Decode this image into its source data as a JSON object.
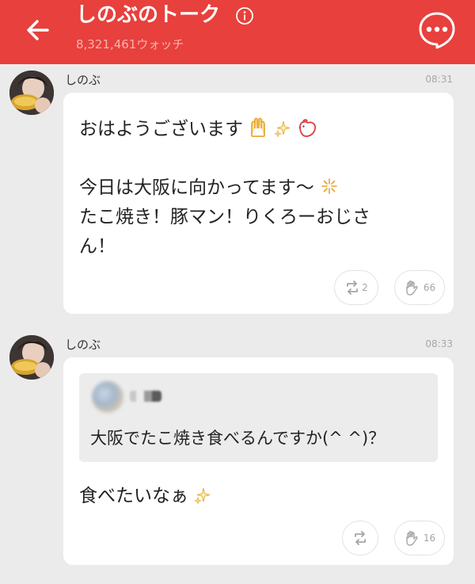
{
  "header": {
    "title": "しのぶのトーク",
    "watchers": "8,321,461ウォッチ",
    "back_icon": "arrow-left-icon",
    "info_icon": "info-icon",
    "chat_icon": "chat-bubble-icon"
  },
  "colors": {
    "header_bg": "#e8403c",
    "background": "#ebebeb",
    "card": "#ffffff"
  },
  "posts": [
    {
      "author": "しのぶ",
      "time": "08:31",
      "lines": [
        "おはようございます",
        "今日は大阪に向かってます〜",
        "たこ焼き！豚マン！りくろーおじさ",
        "ん！"
      ],
      "emoji": [
        "raised-hands-icon",
        "sparkles-icon",
        "chicken-icon",
        "sparkle-icon"
      ],
      "repost_count": "2",
      "clap_count": "66"
    },
    {
      "author": "しのぶ",
      "time": "08:33",
      "quote_text": "大阪でたこ焼き食べるんですか(^ ^)？",
      "reply": "食べたいなぁ",
      "emoji": [
        "sparkles-icon"
      ],
      "repost_count": "",
      "clap_count": "16"
    }
  ]
}
